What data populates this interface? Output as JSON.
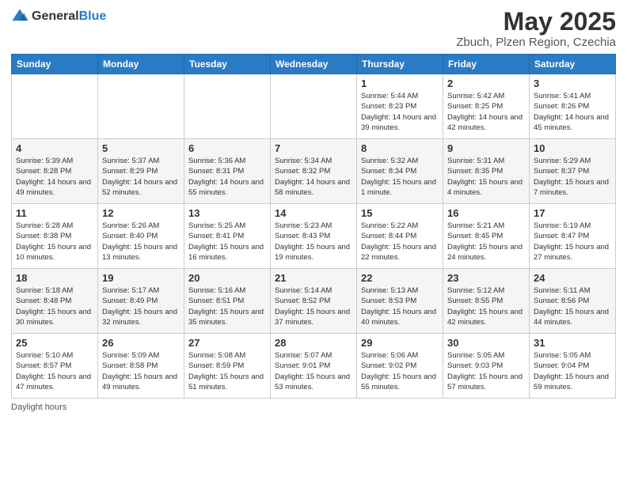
{
  "logo": {
    "general": "General",
    "blue": "Blue"
  },
  "title": "May 2025",
  "subtitle": "Zbuch, Plzen Region, Czechia",
  "days_of_week": [
    "Sunday",
    "Monday",
    "Tuesday",
    "Wednesday",
    "Thursday",
    "Friday",
    "Saturday"
  ],
  "footer": "Daylight hours",
  "weeks": [
    [
      {
        "day": "",
        "info": ""
      },
      {
        "day": "",
        "info": ""
      },
      {
        "day": "",
        "info": ""
      },
      {
        "day": "",
        "info": ""
      },
      {
        "day": "1",
        "info": "Sunrise: 5:44 AM\nSunset: 8:23 PM\nDaylight: 14 hours\nand 39 minutes."
      },
      {
        "day": "2",
        "info": "Sunrise: 5:42 AM\nSunset: 8:25 PM\nDaylight: 14 hours\nand 42 minutes."
      },
      {
        "day": "3",
        "info": "Sunrise: 5:41 AM\nSunset: 8:26 PM\nDaylight: 14 hours\nand 45 minutes."
      }
    ],
    [
      {
        "day": "4",
        "info": "Sunrise: 5:39 AM\nSunset: 8:28 PM\nDaylight: 14 hours\nand 49 minutes."
      },
      {
        "day": "5",
        "info": "Sunrise: 5:37 AM\nSunset: 8:29 PM\nDaylight: 14 hours\nand 52 minutes."
      },
      {
        "day": "6",
        "info": "Sunrise: 5:36 AM\nSunset: 8:31 PM\nDaylight: 14 hours\nand 55 minutes."
      },
      {
        "day": "7",
        "info": "Sunrise: 5:34 AM\nSunset: 8:32 PM\nDaylight: 14 hours\nand 58 minutes."
      },
      {
        "day": "8",
        "info": "Sunrise: 5:32 AM\nSunset: 8:34 PM\nDaylight: 15 hours\nand 1 minute."
      },
      {
        "day": "9",
        "info": "Sunrise: 5:31 AM\nSunset: 8:35 PM\nDaylight: 15 hours\nand 4 minutes."
      },
      {
        "day": "10",
        "info": "Sunrise: 5:29 AM\nSunset: 8:37 PM\nDaylight: 15 hours\nand 7 minutes."
      }
    ],
    [
      {
        "day": "11",
        "info": "Sunrise: 5:28 AM\nSunset: 8:38 PM\nDaylight: 15 hours\nand 10 minutes."
      },
      {
        "day": "12",
        "info": "Sunrise: 5:26 AM\nSunset: 8:40 PM\nDaylight: 15 hours\nand 13 minutes."
      },
      {
        "day": "13",
        "info": "Sunrise: 5:25 AM\nSunset: 8:41 PM\nDaylight: 15 hours\nand 16 minutes."
      },
      {
        "day": "14",
        "info": "Sunrise: 5:23 AM\nSunset: 8:43 PM\nDaylight: 15 hours\nand 19 minutes."
      },
      {
        "day": "15",
        "info": "Sunrise: 5:22 AM\nSunset: 8:44 PM\nDaylight: 15 hours\nand 22 minutes."
      },
      {
        "day": "16",
        "info": "Sunrise: 5:21 AM\nSunset: 8:45 PM\nDaylight: 15 hours\nand 24 minutes."
      },
      {
        "day": "17",
        "info": "Sunrise: 5:19 AM\nSunset: 8:47 PM\nDaylight: 15 hours\nand 27 minutes."
      }
    ],
    [
      {
        "day": "18",
        "info": "Sunrise: 5:18 AM\nSunset: 8:48 PM\nDaylight: 15 hours\nand 30 minutes."
      },
      {
        "day": "19",
        "info": "Sunrise: 5:17 AM\nSunset: 8:49 PM\nDaylight: 15 hours\nand 32 minutes."
      },
      {
        "day": "20",
        "info": "Sunrise: 5:16 AM\nSunset: 8:51 PM\nDaylight: 15 hours\nand 35 minutes."
      },
      {
        "day": "21",
        "info": "Sunrise: 5:14 AM\nSunset: 8:52 PM\nDaylight: 15 hours\nand 37 minutes."
      },
      {
        "day": "22",
        "info": "Sunrise: 5:13 AM\nSunset: 8:53 PM\nDaylight: 15 hours\nand 40 minutes."
      },
      {
        "day": "23",
        "info": "Sunrise: 5:12 AM\nSunset: 8:55 PM\nDaylight: 15 hours\nand 42 minutes."
      },
      {
        "day": "24",
        "info": "Sunrise: 5:11 AM\nSunset: 8:56 PM\nDaylight: 15 hours\nand 44 minutes."
      }
    ],
    [
      {
        "day": "25",
        "info": "Sunrise: 5:10 AM\nSunset: 8:57 PM\nDaylight: 15 hours\nand 47 minutes."
      },
      {
        "day": "26",
        "info": "Sunrise: 5:09 AM\nSunset: 8:58 PM\nDaylight: 15 hours\nand 49 minutes."
      },
      {
        "day": "27",
        "info": "Sunrise: 5:08 AM\nSunset: 8:59 PM\nDaylight: 15 hours\nand 51 minutes."
      },
      {
        "day": "28",
        "info": "Sunrise: 5:07 AM\nSunset: 9:01 PM\nDaylight: 15 hours\nand 53 minutes."
      },
      {
        "day": "29",
        "info": "Sunrise: 5:06 AM\nSunset: 9:02 PM\nDaylight: 15 hours\nand 55 minutes."
      },
      {
        "day": "30",
        "info": "Sunrise: 5:05 AM\nSunset: 9:03 PM\nDaylight: 15 hours\nand 57 minutes."
      },
      {
        "day": "31",
        "info": "Sunrise: 5:05 AM\nSunset: 9:04 PM\nDaylight: 15 hours\nand 59 minutes."
      }
    ]
  ]
}
